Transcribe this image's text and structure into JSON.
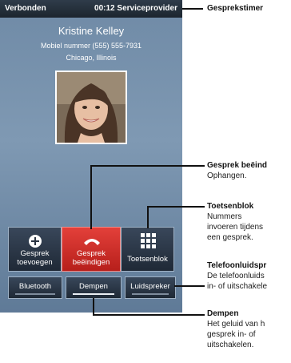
{
  "status_bar": {
    "connection": "Verbonden",
    "time_provider": "00:12 Serviceprovider"
  },
  "contact": {
    "name": "Kristine Kelley",
    "number": "Mobiel nummer (555) 555-7931",
    "location": "Chicago, Illinois"
  },
  "actions": {
    "add_call": [
      "Gesprek",
      "toevoegen"
    ],
    "end_call": [
      "Gesprek",
      "beëindigen"
    ],
    "keypad": "Toetsenblok"
  },
  "toggles": {
    "bluetooth": "Bluetooth",
    "mute": "Dempen",
    "speaker": "Luidspreker"
  },
  "callouts": {
    "timer": "Gesprekstimer",
    "end_call": {
      "title": "Gesprek beëind",
      "text": "Ophangen."
    },
    "keypad": {
      "title": "Toetsenblok",
      "lines": [
        "Nummers",
        "invoeren tijdens",
        "een gesprek."
      ]
    },
    "speaker": {
      "title": "Telefoonluidspr",
      "lines": [
        "De telefoonluids",
        "in- of uitschakele"
      ]
    },
    "mute": {
      "title": "Dempen",
      "lines": [
        "Het geluid van h",
        "gesprek in- of",
        "uitschakelen."
      ]
    }
  },
  "colors": {
    "end_call": "#d9302b",
    "screen_bg": "#7590ab",
    "status_bar": "#243039"
  }
}
